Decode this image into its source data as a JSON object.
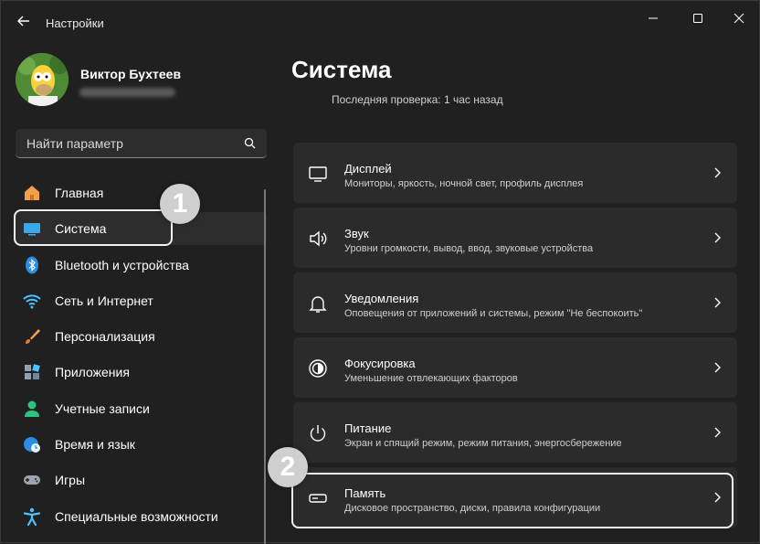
{
  "window": {
    "title": "Настройки",
    "controls": [
      "minimize-icon",
      "maximize-icon",
      "close-icon"
    ]
  },
  "profile": {
    "name": "Виктор Бухтеев"
  },
  "search": {
    "placeholder": "Найти параметр",
    "icon": "search-icon"
  },
  "sidebar": {
    "items": [
      {
        "label": "Главная",
        "icon": "home-icon",
        "active": false
      },
      {
        "label": "Система",
        "icon": "monitor-icon",
        "active": true
      },
      {
        "label": "Bluetooth и устройства",
        "icon": "bluetooth-icon",
        "active": false
      },
      {
        "label": "Сеть и Интернет",
        "icon": "wifi-icon",
        "active": false
      },
      {
        "label": "Персонализация",
        "icon": "brush-icon",
        "active": false
      },
      {
        "label": "Приложения",
        "icon": "apps-icon",
        "active": false
      },
      {
        "label": "Учетные записи",
        "icon": "user-icon",
        "active": false
      },
      {
        "label": "Время и язык",
        "icon": "globe-clock-icon",
        "active": false
      },
      {
        "label": "Игры",
        "icon": "gamepad-icon",
        "active": false
      },
      {
        "label": "Специальные возможности",
        "icon": "accessibility-icon",
        "active": false
      }
    ]
  },
  "main": {
    "title": "Система",
    "last_check": "Последняя проверка: 1 час назад",
    "cards": [
      {
        "title": "Дисплей",
        "subtitle": "Мониторы, яркость, ночной свет, профиль дисплея",
        "icon": "display-icon"
      },
      {
        "title": "Звук",
        "subtitle": "Уровни громкости, вывод, ввод, звуковые устройства",
        "icon": "speaker-icon"
      },
      {
        "title": "Уведомления",
        "subtitle": "Оповещения от приложений и системы, режим \"Не беспокоить\"",
        "icon": "bell-icon"
      },
      {
        "title": "Фокусировка",
        "subtitle": "Уменьшение отвлекающих факторов",
        "icon": "focus-icon"
      },
      {
        "title": "Питание",
        "subtitle": "Экран и спящий режим, режим питания, энергосбережение",
        "icon": "power-icon"
      },
      {
        "title": "Память",
        "subtitle": "Дисковое пространство, диски, правила конфигурации",
        "icon": "storage-icon"
      }
    ]
  },
  "annotations": {
    "badge_1": "1",
    "badge_2": "2"
  },
  "colors": {
    "background": "#202020",
    "card": "#2b2b2b",
    "accent": "#4cc2ff"
  }
}
